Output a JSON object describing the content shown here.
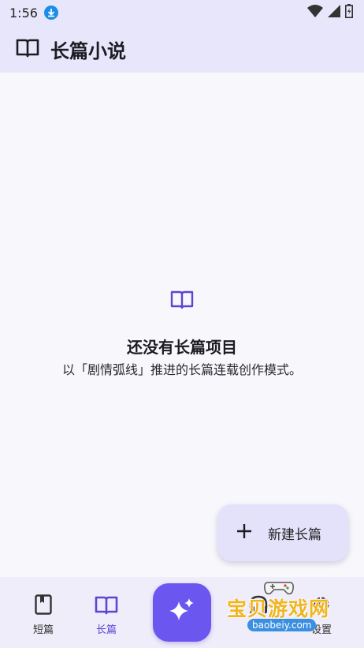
{
  "status_bar": {
    "time": "1:56"
  },
  "app_bar": {
    "title": "长篇小说",
    "icon": "open-book-icon"
  },
  "empty_state": {
    "icon": "open-book-icon",
    "title": "还没有长篇项目",
    "subtitle": "以「剧情弧线」推进的长篇连载创作模式。"
  },
  "fab": {
    "icon": "plus-icon",
    "label": "新建长篇"
  },
  "bottom_nav": {
    "items": [
      {
        "label": "短篇",
        "icon": "book-icon",
        "active": false
      },
      {
        "label": "长篇",
        "icon": "open-book-icon",
        "active": true
      },
      {
        "label": "",
        "icon": "sparkle-icon",
        "active": false
      },
      {
        "label": "",
        "icon": "headphones-icon",
        "active": false
      },
      {
        "label": "设置",
        "icon": "gear-icon",
        "active": false
      }
    ]
  },
  "watermark": {
    "text": "宝贝游戏网",
    "url": "baobeiy.com"
  },
  "colors": {
    "accent": "#6c56f0",
    "active_nav": "#5b46d6",
    "bar_background": "#e8e6fb",
    "page_background": "#f8f8fc"
  }
}
